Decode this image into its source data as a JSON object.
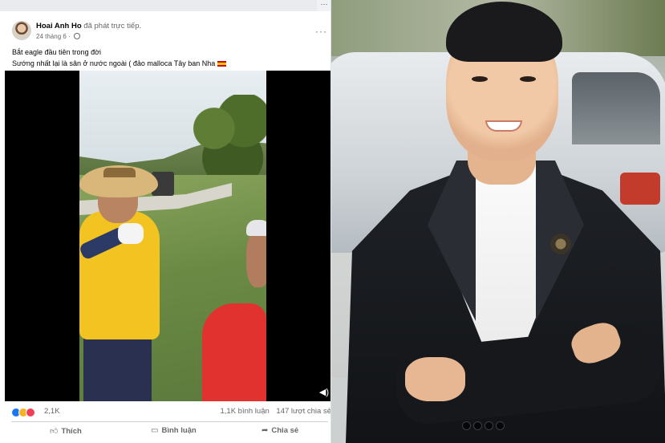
{
  "post": {
    "author_name": "Hoai Anh Ho",
    "author_action": "đã phát trực tiếp.",
    "date": "24 tháng 6",
    "text_line1": "Bắt eagle đầu tiên trong đời",
    "text_line2": "Sướng nhất lại là sân ở nước ngoài ( đảo malloca Tây ban Nha",
    "reactions_count": "2,1K",
    "comments_count": "1,1K bình luận",
    "shares_count": "147 lượt chia sẻ"
  },
  "actions": {
    "like_label": "Thích",
    "comment_label": "Bình luận",
    "share_label": "Chia sẻ"
  },
  "icons": {
    "more": "more-horizontal-icon",
    "privacy": "globe-icon",
    "volume": "volume-icon",
    "flag": "spain-flag-icon"
  },
  "colors": {
    "facebook_blue": "#1877f2",
    "reaction_like": "#1877f2",
    "reaction_haha": "#f7b125",
    "reaction_love": "#f33e58",
    "secondary_text": "#65676b"
  }
}
